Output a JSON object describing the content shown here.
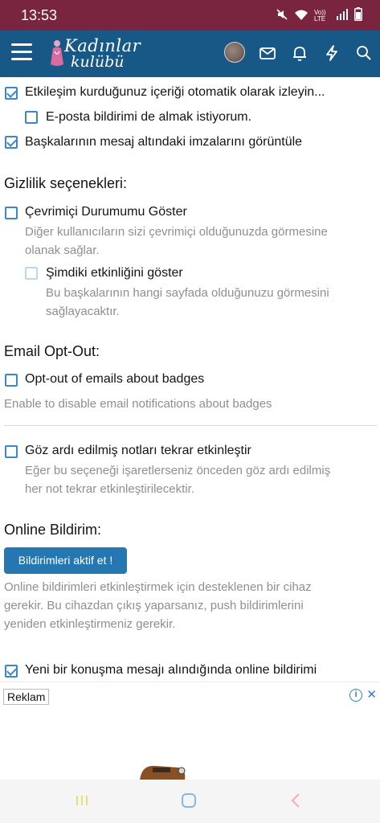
{
  "status_bar": {
    "time": "13:53",
    "icons": [
      "mute-icon",
      "wifi-icon",
      "volte-icon",
      "signal-icon",
      "battery-icon"
    ],
    "network": "Vo)) LTE",
    "color": "#7a2540"
  },
  "header": {
    "logo_line1": "Kadınlar",
    "logo_line2": "kulübü",
    "color": "#185886",
    "icons": [
      "menu-icon",
      "avatar",
      "mail-icon",
      "bell-icon",
      "bolt-icon",
      "search-icon"
    ]
  },
  "prefs": {
    "watch_content": {
      "label": "Etkileşim kurduğunuz içeriği otomatik olarak izleyin...",
      "checked": true
    },
    "email_notify": {
      "label": "E-posta bildirimi de almak istiyorum.",
      "checked": false
    },
    "show_signatures": {
      "label": "Başkalarının mesaj altındaki imzalarını görüntüle",
      "checked": true
    }
  },
  "privacy": {
    "title": "Gizlilik seçenekleri:",
    "show_online": {
      "label": "Çevrimiçi Durumumu Göster",
      "hint_line1": "Diğer kullanıcıların sizi çevrimiçi olduğunuzda görmesine",
      "hint_line2": "olanak sağlar.",
      "checked": false
    },
    "show_activity": {
      "label": "Şimdiki etkinliğini göster",
      "hint_line1": "Bu başkalarının hangi sayfada olduğunuzu görmesini",
      "hint_line2": "sağlayacaktır.",
      "checked": false,
      "disabled": true
    }
  },
  "email_optout": {
    "title": "Email Opt-Out:",
    "badges": {
      "label": "Opt-out of emails about badges",
      "hint": "Enable to disable email notifications about badges",
      "checked": false
    }
  },
  "ignored_notes": {
    "label": "Göz ardı edilmiş notları tekrar etkinleştir",
    "hint_line1": "Eğer bu seçeneği işaretlerseniz önceden göz ardı edilmiş",
    "hint_line2": "her not tekrar etkinleştirilecektir.",
    "checked": false
  },
  "online_notify": {
    "title": "Online Bildirim:",
    "button_label": "Bildirimleri aktif et !",
    "hint_line1": "Online bildirimleri etkinleştirmek için desteklenen bir cihaz",
    "hint_line2": "gerekir. Bu cihazdan çıkış yaparsanız, push bildirimlerini",
    "hint_line3": "yeniden etkinleştirmeniz gerekir.",
    "new_message": {
      "label": "Yeni bir konuşma mesajı alındığında online bildirimi",
      "checked": true
    }
  },
  "ad": {
    "label": "Reklam",
    "info_icon": "info-icon",
    "close_icon": "close-icon"
  },
  "nav": {
    "icons": [
      "recent-apps-icon",
      "home-icon",
      "back-icon"
    ]
  },
  "colors": {
    "accent": "#3b87c8",
    "button": "#2577b1",
    "muted_text": "#8f8f8f"
  }
}
